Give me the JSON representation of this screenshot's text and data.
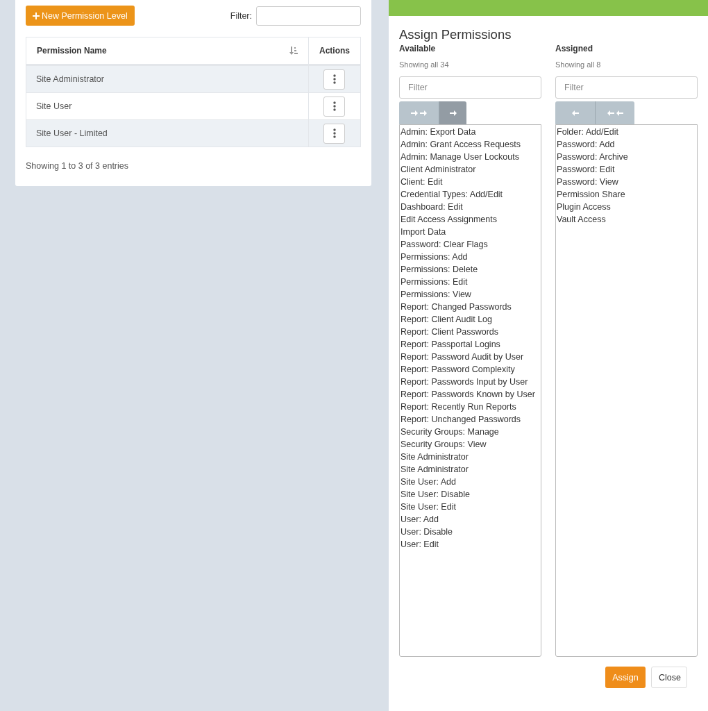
{
  "toolbar": {
    "new_button": "New Permission Level",
    "filter_label": "Filter:"
  },
  "table": {
    "columns": [
      "Permission Name",
      "Actions"
    ],
    "rows": [
      {
        "name": "Site Administrator"
      },
      {
        "name": "Site User"
      },
      {
        "name": "Site User - Limited"
      }
    ],
    "footer": "Showing 1 to 3 of 3 entries"
  },
  "assign_panel": {
    "title": "Assign Permissions",
    "lists": [
      {
        "heading": "Available",
        "count": "Showing all 34",
        "placeholder": "Filter",
        "buttons": [
          {
            "kind": "move-all-right",
            "highlighted": false
          },
          {
            "kind": "move-right",
            "highlighted": true
          }
        ],
        "items": [
          "Admin: Export Data",
          "Admin: Grant Access Requests",
          "Admin: Manage User Lockouts",
          "Client Administrator",
          "Client: Edit",
          "Credential Types: Add/Edit",
          "Dashboard: Edit",
          "Edit Access Assignments",
          "Import Data",
          "Password: Clear Flags",
          "Permissions: Add",
          "Permissions: Delete",
          "Permissions: Edit",
          "Permissions: View",
          "Report: Changed Passwords",
          "Report: Client Audit Log",
          "Report: Client Passwords",
          "Report: Passportal Logins",
          "Report: Password Audit by User",
          "Report: Password Complexity",
          "Report: Passwords Input by User",
          "Report: Passwords Known by User",
          "Report: Recently Run Reports",
          "Report: Unchanged Passwords",
          "Security Groups: Manage",
          "Security Groups: View",
          "Site Administrator",
          "Site Administrator",
          "Site User: Add",
          "Site User: Disable",
          "Site User: Edit",
          "User: Add",
          "User: Disable",
          "User: Edit"
        ]
      },
      {
        "heading": "Assigned",
        "count": "Showing all 8",
        "placeholder": "Filter",
        "buttons": [
          {
            "kind": "move-left",
            "highlighted": false
          },
          {
            "kind": "move-all-left",
            "highlighted": false
          }
        ],
        "items": [
          "Folder: Add/Edit",
          "Password: Add",
          "Password: Archive",
          "Password: Edit",
          "Password: View",
          "Permission Share",
          "Plugin Access",
          "Vault Access"
        ]
      }
    ],
    "actions": [
      {
        "kind": "primary",
        "label": "Assign"
      },
      {
        "kind": "secondary",
        "label": "Close"
      }
    ]
  }
}
